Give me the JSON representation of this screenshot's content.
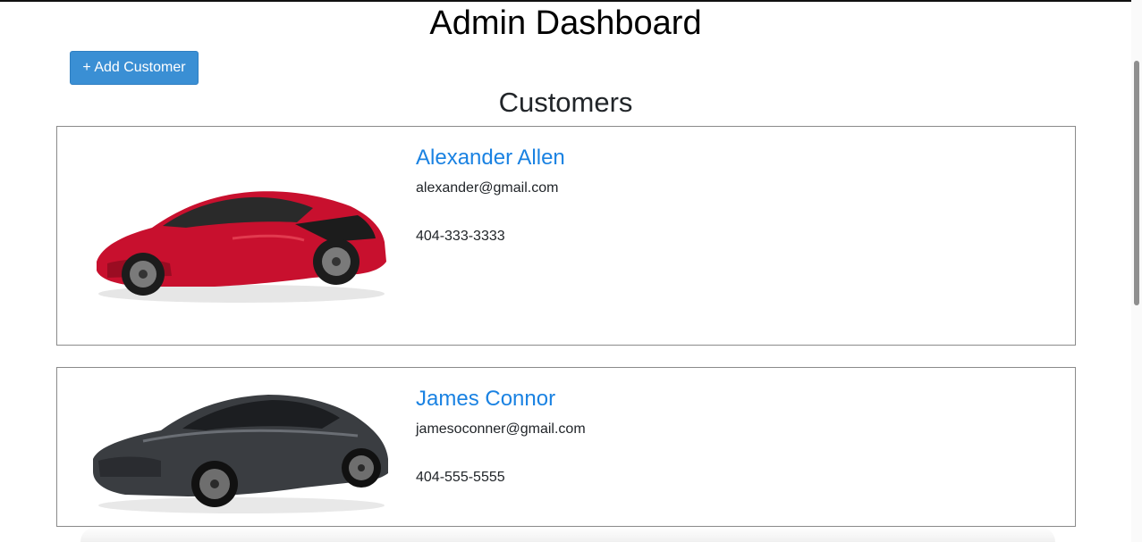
{
  "page": {
    "title": "Admin Dashboard"
  },
  "toolbar": {
    "add_customer_label": "+ Add Customer"
  },
  "customers_section": {
    "title": "Customers",
    "customers": [
      {
        "name": "Alexander Allen",
        "email": "alexander@gmail.com",
        "phone": "404-333-3333",
        "car_icon": "red-sports-car-image",
        "car_color": "#c8102e"
      },
      {
        "name": "James Connor",
        "email": "jamesoconner@gmail.com",
        "phone": "404-555-5555",
        "car_icon": "dark-grey-sports-car-image",
        "car_color": "#3a3d41"
      }
    ]
  },
  "colors": {
    "link": "#1a82e2",
    "button": "#3a8fd4",
    "card_border": "#8a8a8a"
  }
}
